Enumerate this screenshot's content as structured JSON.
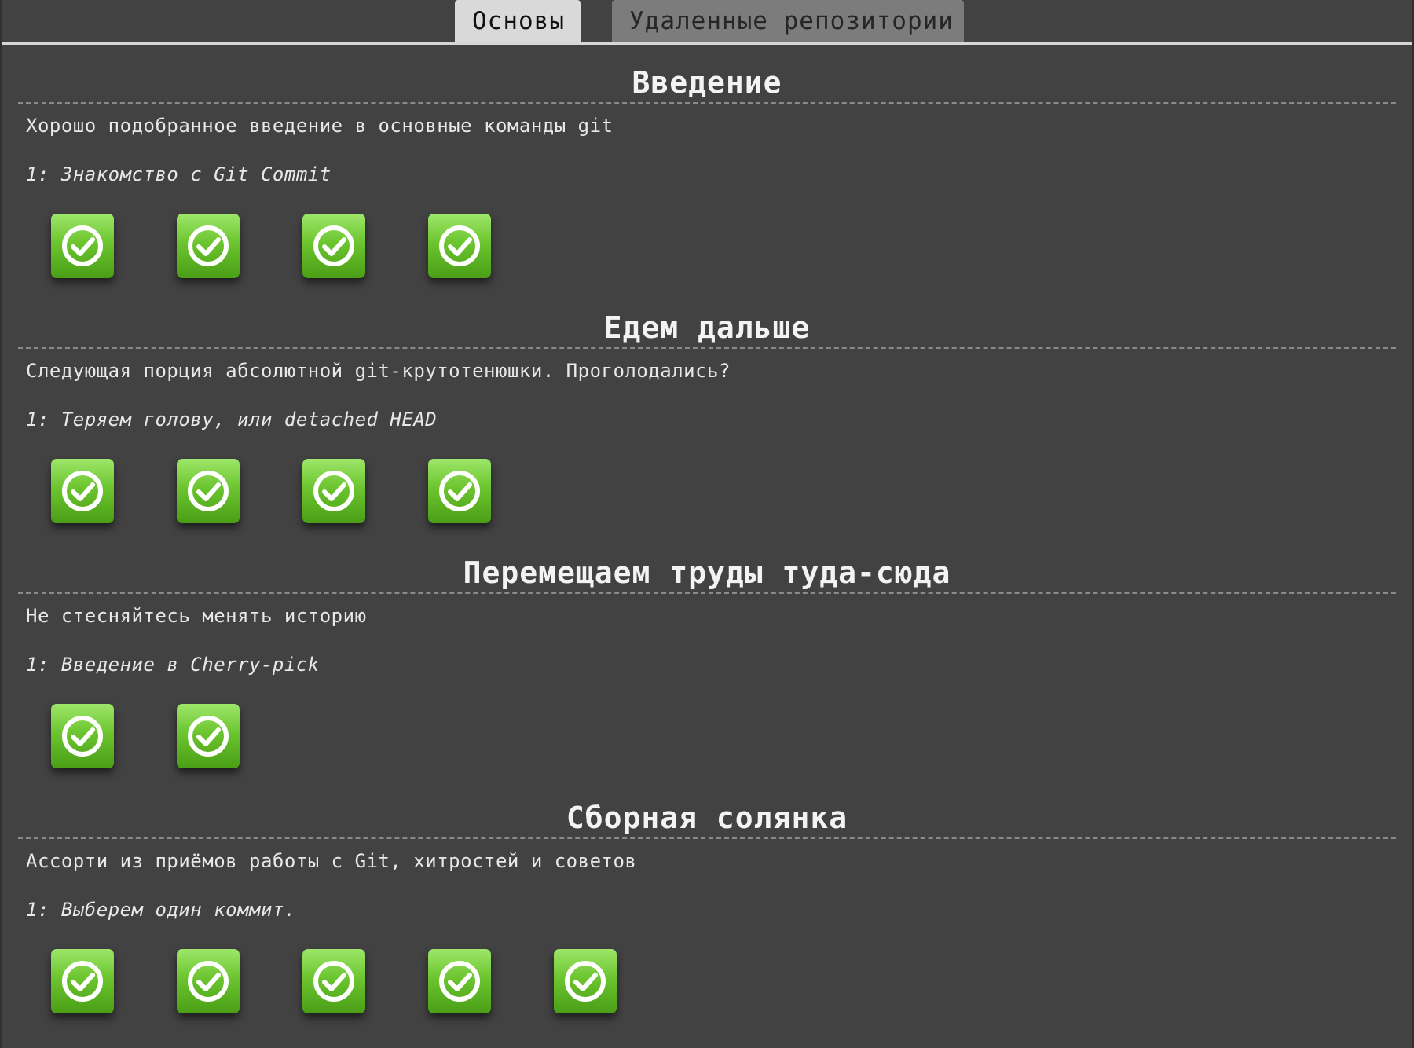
{
  "tabs": {
    "main": "Основы",
    "remote": "Удаленные репозитории"
  },
  "sequences": [
    {
      "title": "Введение",
      "description": "Хорошо подобранное введение в основные команды git",
      "current": "1: Знакомство с Git Commit",
      "levels_total": 4,
      "levels_completed": 4
    },
    {
      "title": "Едем дальше",
      "description": "Следующая порция абсолютной git-крутотенюшки. Проголодались?",
      "current": "1: Теряем голову, или detached HEAD",
      "levels_total": 4,
      "levels_completed": 4
    },
    {
      "title": "Перемещаем труды туда-сюда",
      "description": "Не стесняйтесь менять историю",
      "current": "1: Введение в Cherry-pick",
      "levels_total": 2,
      "levels_completed": 2
    },
    {
      "title": "Сборная солянка",
      "description": "Ассорти из приёмов работы с Git, хитростей и советов",
      "current": "1: Выберем один коммит.",
      "levels_total": 5,
      "levels_completed": 5
    }
  ],
  "icons": {
    "level_icon": "check-circle-icon"
  },
  "colors": {
    "background": "#424242",
    "level_green": "#6cc52f",
    "tab_active": "#d9d9d9",
    "tab_inactive": "#7c7c7c"
  }
}
